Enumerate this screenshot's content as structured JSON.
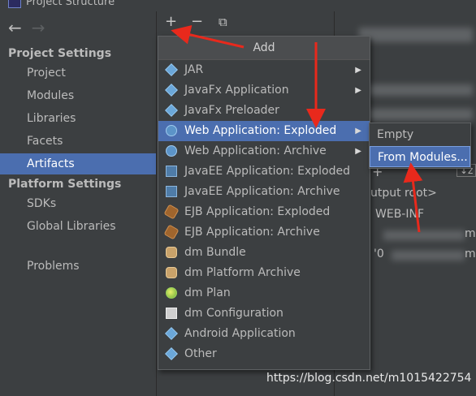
{
  "window": {
    "title": "Project Structure"
  },
  "nav": {
    "back": "←",
    "forward": "→"
  },
  "toolbar": {
    "add": "+",
    "remove": "−",
    "copy": "⧉"
  },
  "sidebar": {
    "project_settings": "Project Settings",
    "project_items": [
      "Project",
      "Modules",
      "Libraries",
      "Facets",
      "Artifacts"
    ],
    "platform_settings": "Platform Settings",
    "platform_items": [
      "SDKs",
      "Global Libraries"
    ],
    "problems": "Problems"
  },
  "add_menu": {
    "header": "Add",
    "items": [
      {
        "label": "JAR",
        "icon": "diamond-icon"
      },
      {
        "label": "JavaFx Application",
        "icon": "diamond-icon"
      },
      {
        "label": "JavaFx Preloader",
        "icon": "diamond-icon"
      },
      {
        "label": "Web Application: Exploded",
        "icon": "globe-icon"
      },
      {
        "label": "Web Application: Archive",
        "icon": "globe-icon"
      },
      {
        "label": "JavaEE Application: Exploded",
        "icon": "javaee-icon"
      },
      {
        "label": "JavaEE Application: Archive",
        "icon": "javaee-icon"
      },
      {
        "label": "EJB Application: Exploded",
        "icon": "ejb-icon"
      },
      {
        "label": "EJB Application: Archive",
        "icon": "ejb-icon"
      },
      {
        "label": "dm Bundle",
        "icon": "bundle-icon"
      },
      {
        "label": "dm Platform Archive",
        "icon": "bundle-icon"
      },
      {
        "label": "dm Plan",
        "icon": "plan-icon"
      },
      {
        "label": "dm Configuration",
        "icon": "document-icon"
      },
      {
        "label": "Android Application",
        "icon": "diamond-icon"
      },
      {
        "label": "Other",
        "icon": "diamond-icon"
      }
    ]
  },
  "submenu": {
    "items": [
      "Empty",
      "From Modules..."
    ]
  },
  "right_pane": {
    "output_root": "utput root>",
    "webinf": "WEB-INF",
    "m1": "m",
    "zero": "'0",
    "m2": "m"
  },
  "watermark": "https://blog.csdn.net/m1015422754",
  "colors": {
    "selection": "#4b6eaf",
    "background": "#3c3f41",
    "annotation": "#e8291c"
  }
}
